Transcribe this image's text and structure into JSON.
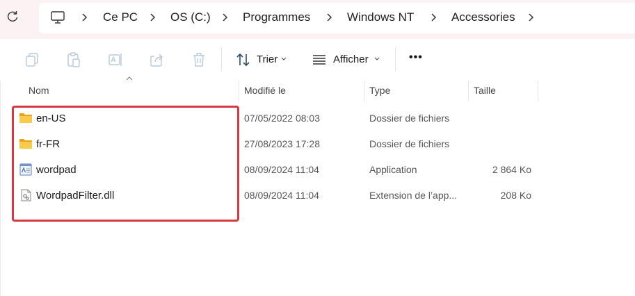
{
  "breadcrumb": [
    "Ce PC",
    "OS (C:)",
    "Programmes",
    "Windows NT",
    "Accessories"
  ],
  "icons": {
    "refresh": "refresh-icon",
    "computer": "computer-icon",
    "chevron": "chevron-right-icon"
  },
  "toolbar": {
    "sort_label": "Trier",
    "view_label": "Afficher",
    "more_label": "•••"
  },
  "columns": {
    "name": "Nom",
    "modified": "Modifié le",
    "type": "Type",
    "size": "Taille"
  },
  "files": [
    {
      "name": "en-US",
      "modified": "07/05/2022 08:03",
      "type": "Dossier de fichiers",
      "size": "",
      "icon": "folder-icon"
    },
    {
      "name": "fr-FR",
      "modified": "27/08/2023 17:28",
      "type": "Dossier de fichiers",
      "size": "",
      "icon": "folder-icon"
    },
    {
      "name": "wordpad",
      "modified": "08/09/2024 11:04",
      "type": "Application",
      "size": "2 864 Ko",
      "icon": "application-icon"
    },
    {
      "name": "WordpadFilter.dll",
      "modified": "08/09/2024 11:04",
      "type": "Extension de l’app...",
      "size": "208 Ko",
      "icon": "dll-file-icon"
    }
  ],
  "colors": {
    "address_bar_bg": "#fbf2f3",
    "highlight_border": "#d63a3e",
    "folder_yellow": "#f4c542"
  }
}
